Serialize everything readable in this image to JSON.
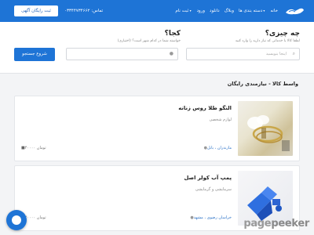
{
  "header": {
    "logo_icon": "handshake-logo-icon",
    "nav": [
      {
        "label": "خانه",
        "caret": false
      },
      {
        "label": "دسته بندی ها",
        "caret": true
      },
      {
        "label": "وبلاگ",
        "caret": false
      },
      {
        "label": "دانلود",
        "caret": false
      },
      {
        "label": "ورود",
        "caret": false
      },
      {
        "label": "ثبت نام",
        "caret": true
      }
    ],
    "phone": "تماس: ۰۳۳۴۴۷۳۴۶۶۲",
    "post_ad_label": "ثبت رایگان آگهی",
    "brand_color": "#1e74d6"
  },
  "search": {
    "what_title": "چه چیزی؟",
    "what_subtitle": "لطفا کالا یا خدماتی که نیاز دارید را وارد کنید",
    "what_placeholder": "اینجا بنویسید",
    "where_title": "کجا؟",
    "where_subtitle": "خواسته شما در کدام شهر است؟ (اختیاری)",
    "submit_label": "شروع جستجو"
  },
  "section": {
    "title": "واسط کالا - نیازمندی رایگان"
  },
  "listings": [
    {
      "title": "النگو طلا روس زنانه",
      "category": "لوازم شخصی",
      "location": "مازندران ، بابل",
      "price": "۴۰۰۰۰ تومان",
      "image_icon": "gold-bangle-photo"
    },
    {
      "title": "پمپ آب کولر اصل",
      "category": "سرمایشی و گرمایشی",
      "location": "خراسان رضوی ، مشهد",
      "price": "۴۰۰۰۰ تومان",
      "image_icon": "blue-water-pump-photo"
    }
  ],
  "chat": {
    "icon": "chat-support-icon"
  },
  "watermark": {
    "part_a": "page",
    "part_b": "peeker"
  }
}
